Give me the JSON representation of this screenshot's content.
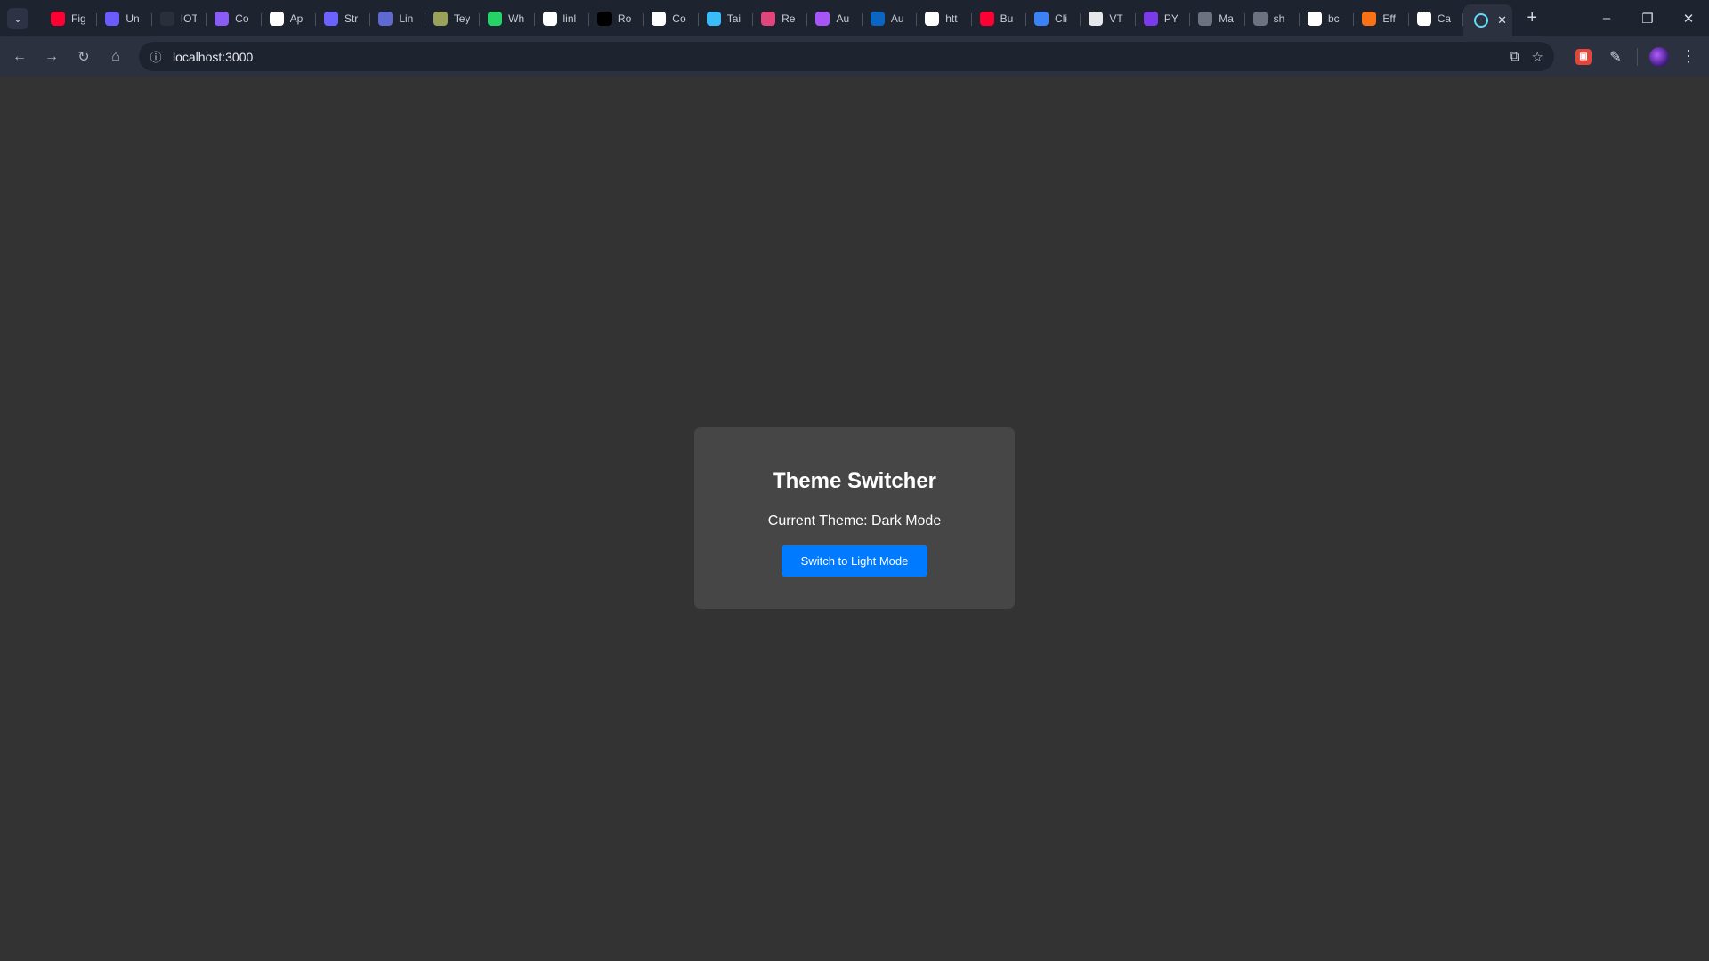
{
  "browser": {
    "tabs": [
      {
        "title": "Fig",
        "icon": "youtube-icon",
        "color": "#ff0033"
      },
      {
        "title": "Un",
        "icon": "chart-icon",
        "color": "#6a5cff"
      },
      {
        "title": "IOT",
        "icon": "circuit-icon",
        "color": "#2b2f3a"
      },
      {
        "title": "Co",
        "icon": "w-logo-icon",
        "color": "#8a5cf6"
      },
      {
        "title": "Ap",
        "icon": "circle-logo-icon",
        "color": "#ffffff"
      },
      {
        "title": "Str",
        "icon": "s-logo-icon",
        "color": "#6c63ff"
      },
      {
        "title": "Lin",
        "icon": "linear-logo-icon",
        "color": "#5e6ad2"
      },
      {
        "title": "Tey",
        "icon": "globe-icon",
        "color": "#9aa25a"
      },
      {
        "title": "Wh",
        "icon": "whatsapp-icon",
        "color": "#25d366"
      },
      {
        "title": "linl",
        "icon": "github-icon",
        "color": "#ffffff"
      },
      {
        "title": "Ro",
        "icon": "n-logo-icon",
        "color": "#000000"
      },
      {
        "title": "Co",
        "icon": "github-icon",
        "color": "#ffffff"
      },
      {
        "title": "Tai",
        "icon": "tailwind-icon",
        "color": "#38bdf8"
      },
      {
        "title": "Re",
        "icon": "react-icon",
        "color": "#e0457b"
      },
      {
        "title": "Au",
        "icon": "shield-icon",
        "color": "#a855f7"
      },
      {
        "title": "Au",
        "icon": "linkedin-icon",
        "color": "#0a66c2"
      },
      {
        "title": "htt",
        "icon": "google-icon",
        "color": "#ffffff"
      },
      {
        "title": "Bu",
        "icon": "youtube-icon",
        "color": "#ff0033"
      },
      {
        "title": "Cli",
        "icon": "shield-icon",
        "color": "#3b82f6"
      },
      {
        "title": "VT",
        "icon": "document-icon",
        "color": "#e5e7eb"
      },
      {
        "title": "PY",
        "icon": "dot-icon",
        "color": "#7c3aed"
      },
      {
        "title": "Ma",
        "icon": "code-icon",
        "color": "#6b7280"
      },
      {
        "title": "sh",
        "icon": "code-icon",
        "color": "#6b7280"
      },
      {
        "title": "bc",
        "icon": "github-icon",
        "color": "#ffffff"
      },
      {
        "title": "Eff",
        "icon": "spark-icon",
        "color": "#f97316"
      },
      {
        "title": "Ca",
        "icon": "openai-icon",
        "color": "#ffffff"
      }
    ],
    "active_tab": {
      "icon": "react-icon",
      "color": "#61dafb"
    },
    "url": "localhost:3000"
  },
  "app": {
    "title": "Theme Switcher",
    "status": "Current Theme: Dark Mode",
    "button_label": "Switch to Light Mode",
    "button_color": "#007bff",
    "background_color": "#333333",
    "card_color": "#464646"
  }
}
